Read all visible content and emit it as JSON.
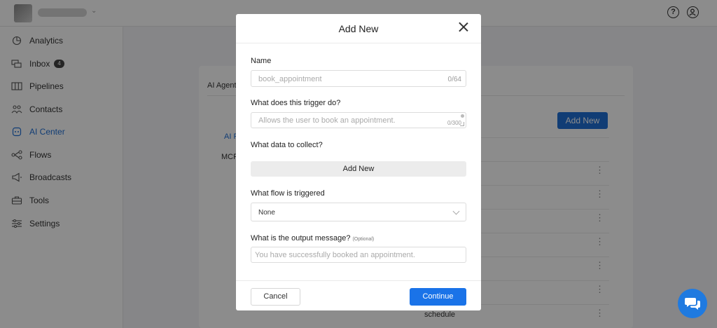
{
  "sidebar": {
    "items": [
      {
        "label": "Analytics",
        "icon": "analytics-icon"
      },
      {
        "label": "Inbox",
        "icon": "inbox-icon",
        "badge": "4"
      },
      {
        "label": "Pipelines",
        "icon": "pipelines-icon"
      },
      {
        "label": "Contacts",
        "icon": "contacts-icon"
      },
      {
        "label": "AI Center",
        "icon": "ai-center-icon",
        "active": true
      },
      {
        "label": "Flows",
        "icon": "flows-icon"
      },
      {
        "label": "Broadcasts",
        "icon": "broadcasts-icon"
      },
      {
        "label": "Tools",
        "icon": "tools-icon"
      },
      {
        "label": "Settings",
        "icon": "settings-icon"
      }
    ]
  },
  "background": {
    "tab_label": "AI Agents",
    "add_new_label": "Add New",
    "ai_link": "AI F",
    "mcp_label": "MCP",
    "row_text": "schedule"
  },
  "modal": {
    "title": "Add New",
    "name": {
      "label": "Name",
      "placeholder": "book_appointment",
      "counter": "0/64"
    },
    "trigger": {
      "label": "What does this trigger do?",
      "placeholder": "Allows the user to book an appointment.",
      "counter": "0/300"
    },
    "collect": {
      "label": "What data to collect?",
      "button_label": "Add New"
    },
    "flow": {
      "label": "What flow is triggered",
      "value": "None"
    },
    "output": {
      "label": "What is the output message?",
      "optional": "(Optional)",
      "placeholder": "You have successfully booked an appointment."
    },
    "cancel_label": "Cancel",
    "continue_label": "Continue"
  },
  "colors": {
    "accent": "#1a73e8",
    "active_nav": "#1f6fd6"
  }
}
